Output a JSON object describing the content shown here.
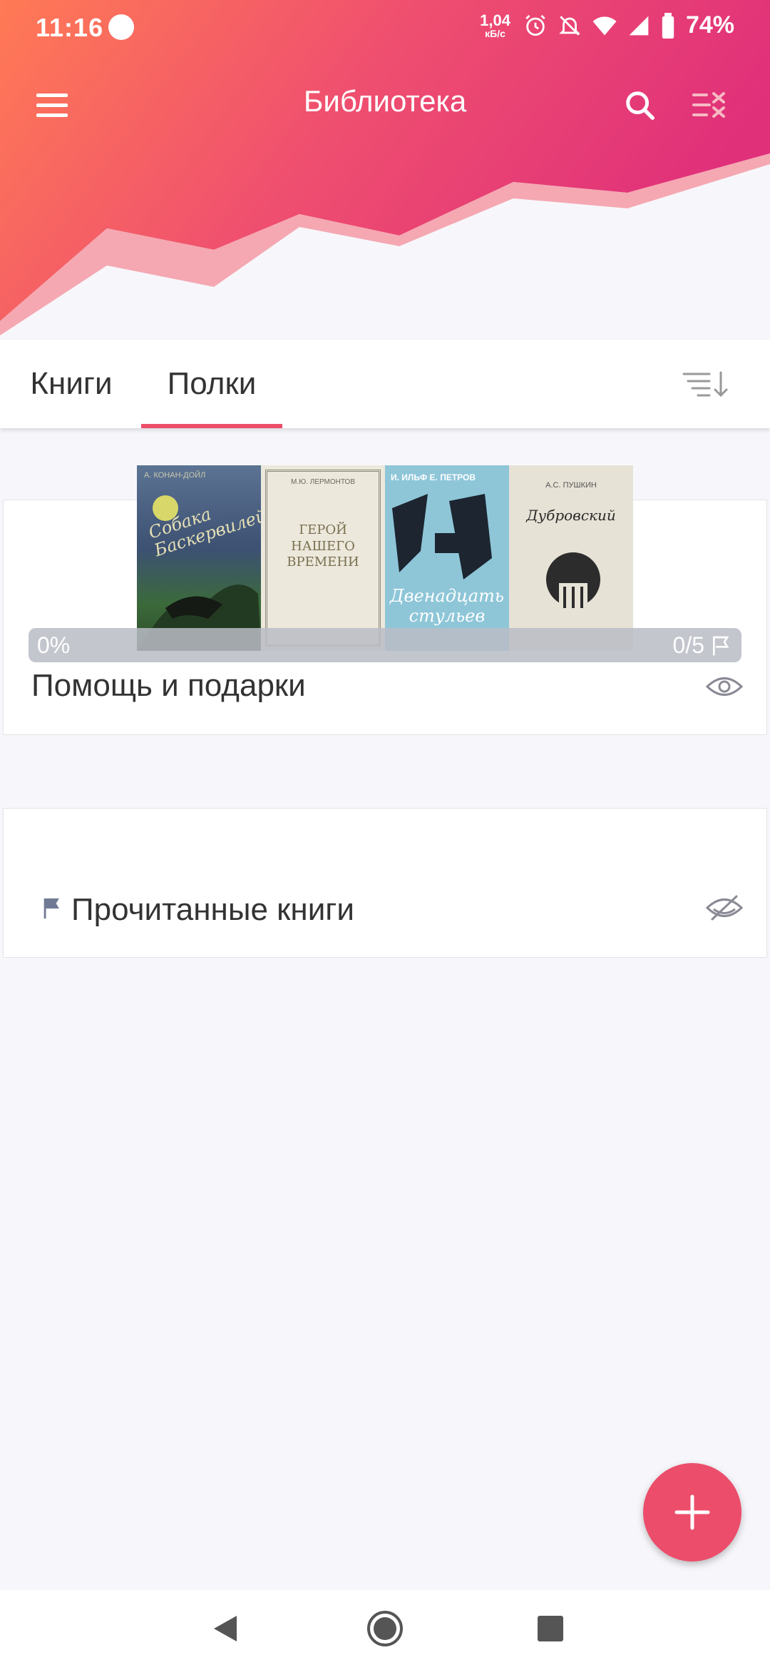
{
  "status_bar": {
    "time": "11:16",
    "net_speed_value": "1,04",
    "net_speed_unit": "кБ/с",
    "battery": "74%"
  },
  "app_bar": {
    "title": "Библиотека",
    "icons": [
      "menu-icon",
      "search-icon",
      "select-checklist-icon"
    ]
  },
  "tabs": {
    "items": [
      {
        "label": "Книги"
      },
      {
        "label": "Полки"
      }
    ],
    "active": "Полки",
    "sort_icon": "sort-icon"
  },
  "shelves": [
    {
      "title": "Помощь и подарки",
      "progress_percent": "0%",
      "progress_count": "0/5",
      "visibility_icon": "eye-icon",
      "covers": [
        {
          "title": "Собака Баскервилей",
          "author": "А. КОНАН-ДОЙЛ"
        },
        {
          "title": "ГЕРОЙ НАШЕГО ВРЕМЕНИ",
          "author": "М.Ю. ЛЕРМОНТОВ"
        },
        {
          "title": "Двенадцать стульев",
          "author": "И. ИЛЬФ Е. ПЕТРОВ"
        },
        {
          "title": "Дубровский",
          "author": "А.С. ПУШКИН"
        }
      ]
    },
    {
      "title": "Прочитанные книги",
      "flag_icon": "flag-icon",
      "visibility_icon": "eye-off-icon"
    }
  ],
  "fab": {
    "icon": "plus-icon"
  },
  "colors": {
    "accent": "#ec4d6a",
    "header_gradient_start": "#ff7a55",
    "header_gradient_end": "#e0307a",
    "background": "#f7f7fb"
  }
}
